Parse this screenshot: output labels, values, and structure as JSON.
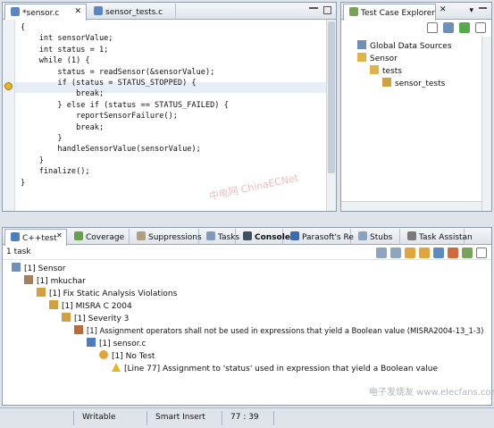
{
  "editor": {
    "tabs": [
      {
        "label": "*sensor.c",
        "active": true
      },
      {
        "label": "sensor_tests.c",
        "active": false
      }
    ],
    "code_lines": [
      "{",
      "    int sensorValue;",
      "    int status = 1;",
      "    while (1) {",
      "        status = readSensor(&sensorValue);",
      "        if (status = STATUS_STOPPED) {",
      "            break;",
      "        } else if (status == STATUS_FAILED) {",
      "            reportSensorFailure();",
      "            break;",
      "        }",
      "        handleSensorValue(sensorValue);",
      "    }",
      "    finalize();",
      "}"
    ]
  },
  "explorer": {
    "tab_label": "Test Case Explorer",
    "tree": [
      {
        "label": "Global Data Sources",
        "icon": "global-data-icon"
      },
      {
        "label": "Sensor",
        "icon": "folder-icon"
      },
      {
        "label": "tests",
        "icon": "folder-icon"
      },
      {
        "label": "sensor_tests",
        "icon": "test-suite-icon"
      }
    ]
  },
  "bottom": {
    "tabs": [
      {
        "label": "C++test",
        "active": true
      },
      {
        "label": "Coverage"
      },
      {
        "label": "Suppressions"
      },
      {
        "label": "Tasks"
      },
      {
        "label": "Console"
      },
      {
        "label": "Parasoft's Re"
      },
      {
        "label": "Stubs"
      },
      {
        "label": "Task Assistan"
      }
    ],
    "task_count": "1 task",
    "tree": [
      {
        "label": "[1] Sensor",
        "icon": "project-icon"
      },
      {
        "label": "[1] mkuchar",
        "icon": "user-icon"
      },
      {
        "label": "[1] Fix Static Analysis Violations",
        "icon": "folder-icon"
      },
      {
        "label": "[1] MISRA C 2004",
        "icon": "folder-icon"
      },
      {
        "label": "[1] Severity 3",
        "icon": "folder-icon"
      },
      {
        "label": "[1] Assignment operators shall not be used in expressions that yield a Boolean value (MISRA2004-13_1-3)",
        "icon": "rule-icon"
      },
      {
        "label": "[1] sensor.c",
        "icon": "file-icon"
      },
      {
        "label": "[1] No Test",
        "icon": "no-test-icon"
      },
      {
        "label": "[Line 77] Assignment to 'status' used in expression that yield a Boolean value",
        "icon": "warning-icon"
      }
    ]
  },
  "statusbar": {
    "writable": "Writable",
    "insert_mode": "Smart Insert",
    "position": "77 : 39"
  },
  "watermarks": {
    "top": "中电网 ChinaECNet",
    "bottom": "电子发烧友 www.elecfans.com"
  }
}
